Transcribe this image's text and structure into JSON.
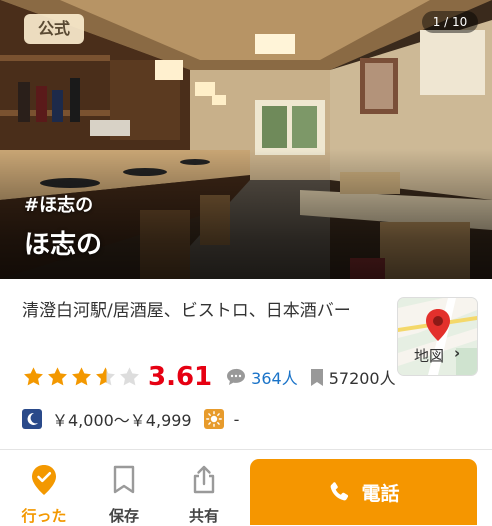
{
  "hero": {
    "badge": "公式",
    "photo_counter": "1 / 10",
    "hashtag": "#ほ志の",
    "shop_name": "ほ志の"
  },
  "info": {
    "category": "清澄白河駅/居酒屋、ビストロ、日本酒バー",
    "map_label": "地図",
    "map_chevron": "›",
    "rating": 3.61,
    "rating_text": "3.61",
    "review_count": "364人",
    "save_count": "57200人",
    "price_dinner": "￥4,000〜￥4,999",
    "price_lunch": "-"
  },
  "bottom_bar": {
    "went_label": "行った",
    "save_label": "保存",
    "share_label": "共有",
    "call_label": "電話"
  },
  "colors": {
    "accent": "#f39800",
    "call_button": "#f59600",
    "score": "#e60012",
    "link": "#1a73c8",
    "moon_box": "#2a4a8a",
    "sun_box": "#e79b2c"
  },
  "icons": [
    "map-pin-icon",
    "speech-bubble-icon",
    "bookmark-icon",
    "moon-icon",
    "sun-icon",
    "check-badge-icon",
    "share-icon",
    "phone-icon"
  ]
}
